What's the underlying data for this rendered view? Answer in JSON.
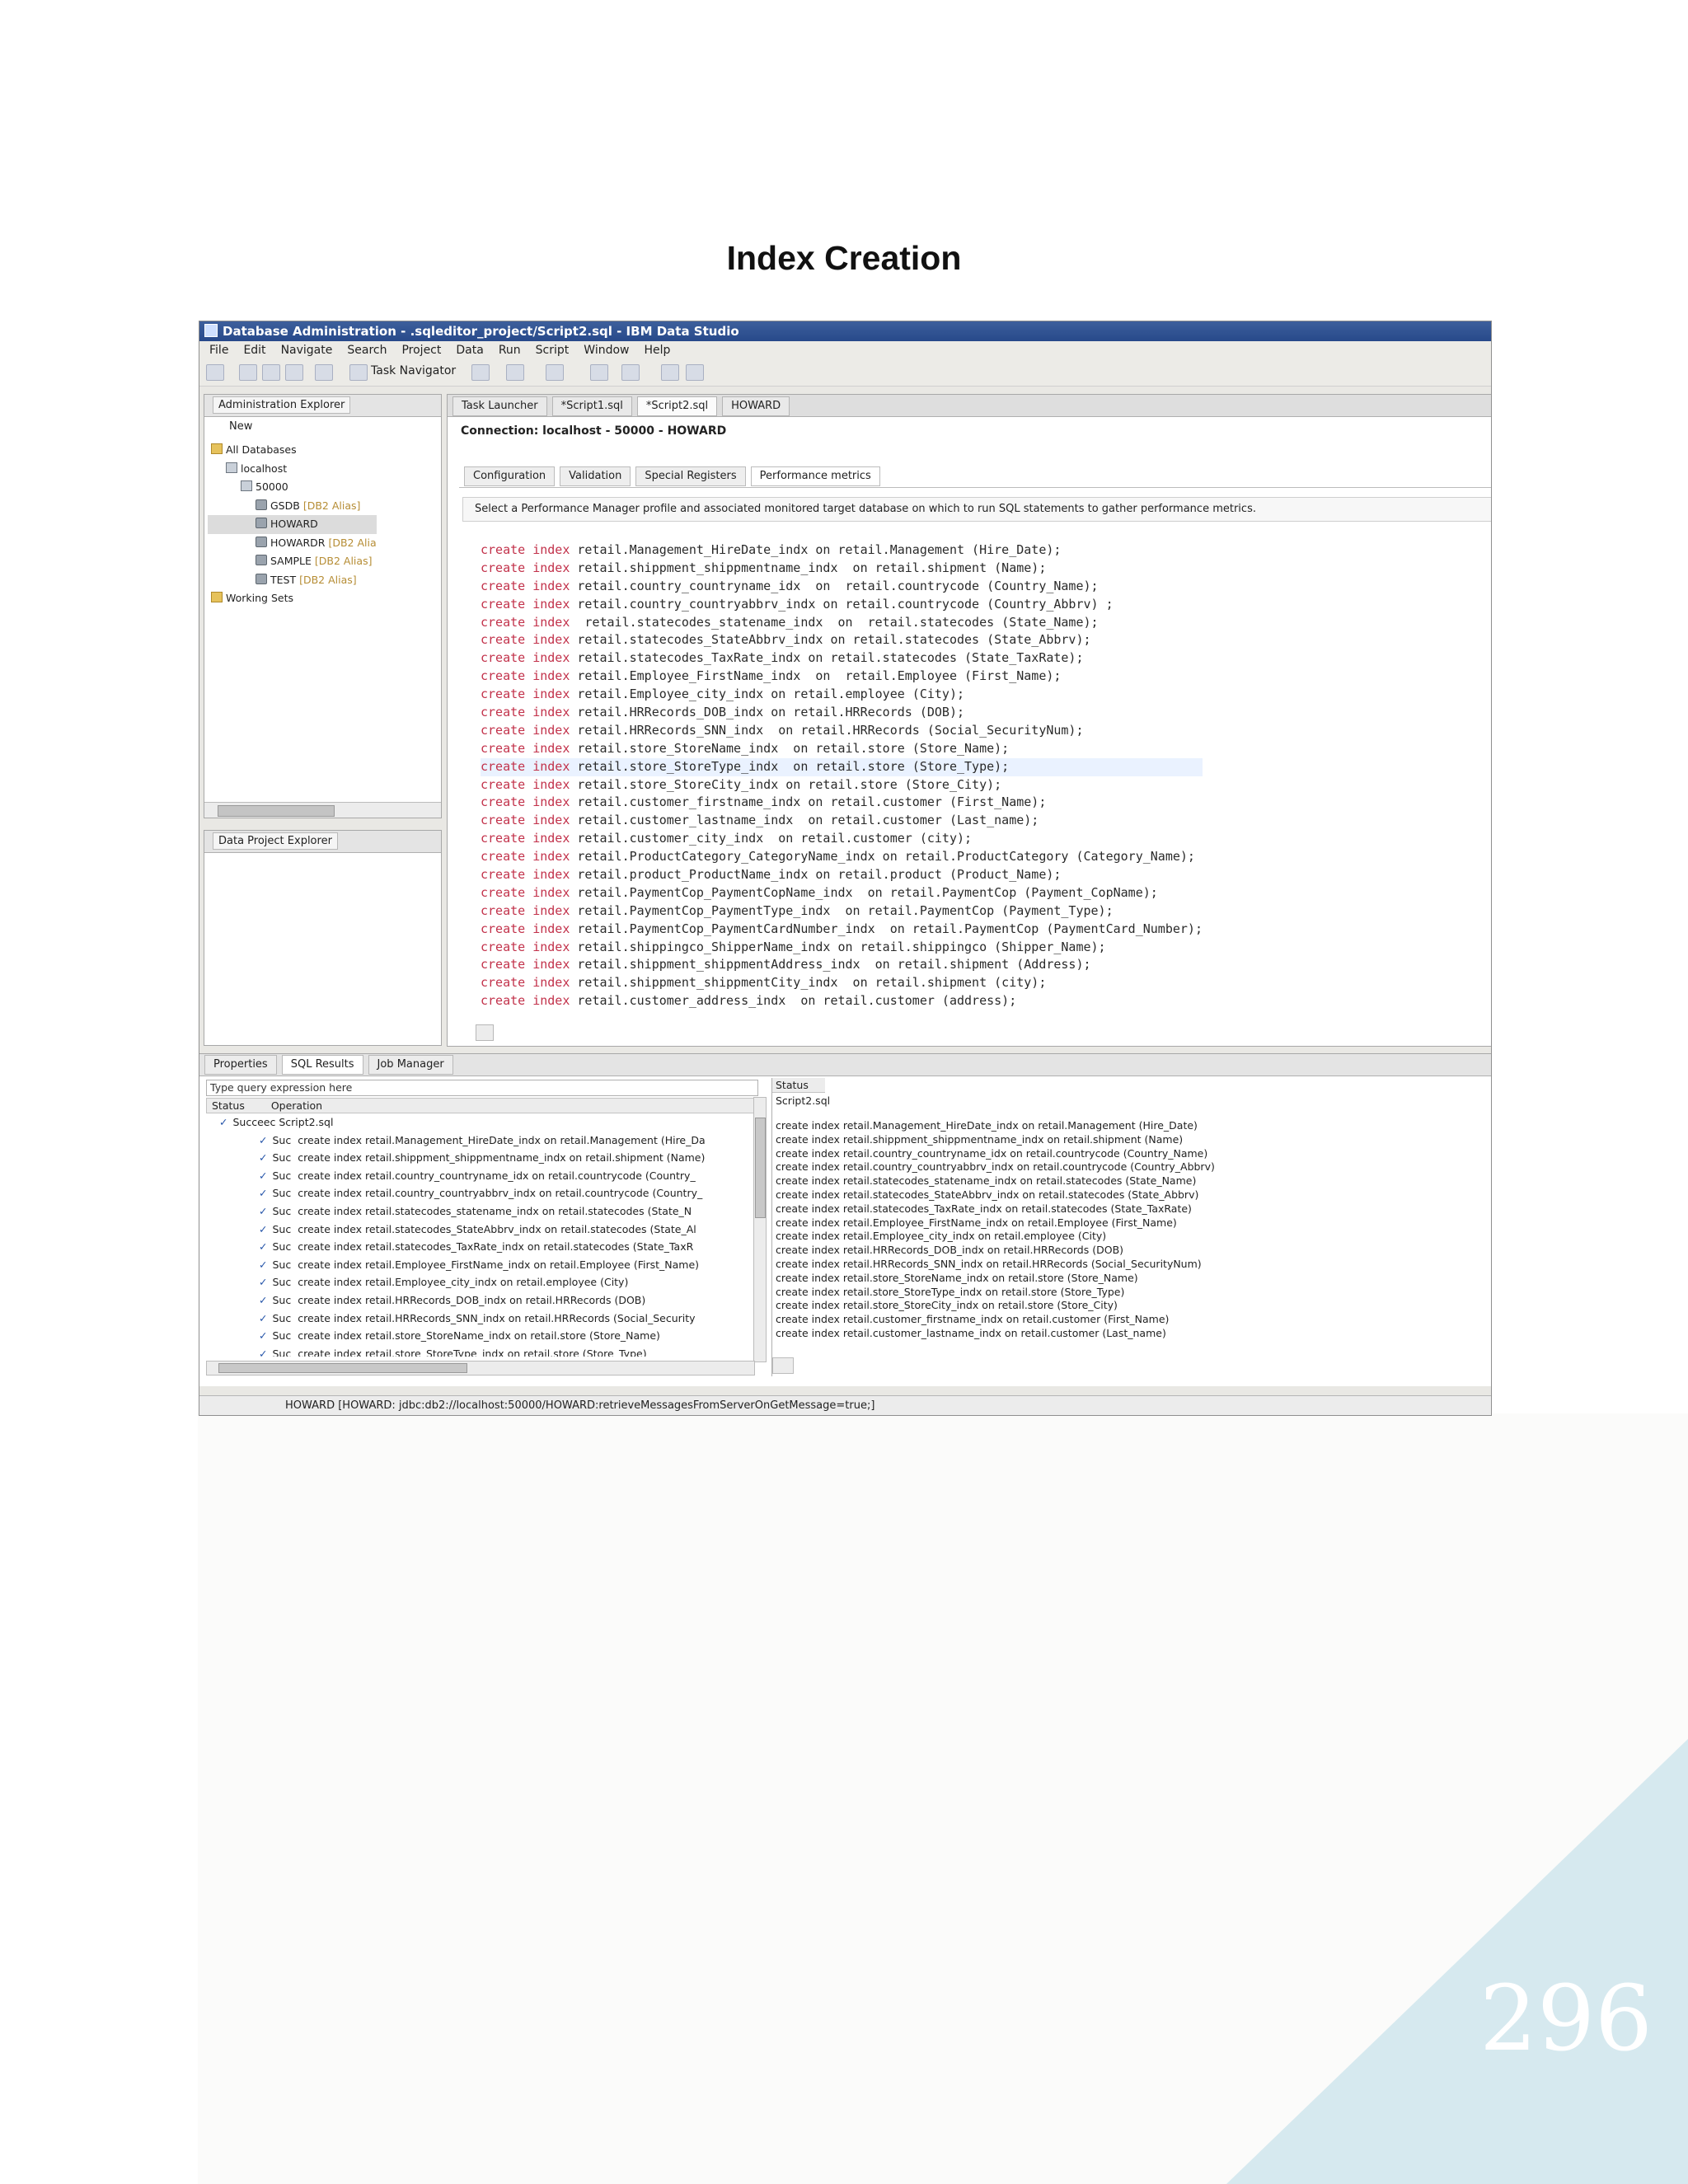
{
  "page": {
    "title": "Index Creation",
    "number": "296"
  },
  "window": {
    "title": "Database Administration - .sqleditor_project/Script2.sql - IBM Data Studio",
    "menu": [
      "File",
      "Edit",
      "Navigate",
      "Search",
      "Project",
      "Data",
      "Run",
      "Script",
      "Window",
      "Help"
    ],
    "toolbar": {
      "task_navigator": "Task Navigator"
    }
  },
  "admin_explorer": {
    "tab": "Administration Explorer",
    "new_label": "New",
    "tree": [
      {
        "label": "All Databases",
        "alias": ""
      },
      {
        "label": "localhost",
        "alias": ""
      },
      {
        "label": "50000",
        "alias": ""
      },
      {
        "label": "GSDB",
        "alias": "[DB2 Alias]"
      },
      {
        "label": "HOWARD",
        "alias": ""
      },
      {
        "label": "HOWARDR",
        "alias": "[DB2 Alia"
      },
      {
        "label": "SAMPLE",
        "alias": "[DB2 Alias]"
      },
      {
        "label": "TEST",
        "alias": "[DB2 Alias]"
      },
      {
        "label": "Working Sets",
        "alias": ""
      }
    ]
  },
  "data_project_explorer": {
    "tab": "Data Project Explorer"
  },
  "editor": {
    "tabs": [
      "Task Launcher",
      "*Script1.sql",
      "*Script2.sql",
      "HOWARD"
    ],
    "connection": "Connection: localhost - 50000 - HOWARD",
    "config_tabs": [
      "Configuration",
      "Validation",
      "Special Registers",
      "Performance metrics"
    ],
    "config_description": "Select a Performance Manager profile and associated monitored target database on which to run SQL statements to gather performance metrics.",
    "keyword": "create index",
    "lines": [
      " retail.Management_HireDate_indx on retail.Management (Hire_Date);",
      " retail.shippment_shippmentname_indx  on retail.shipment (Name);",
      " retail.country_countryname_idx  on  retail.countrycode (Country_Name);",
      " retail.country_countryabbrv_indx on retail.countrycode (Country_Abbrv) ;",
      "  retail.statecodes_statename_indx  on  retail.statecodes (State_Name);",
      " retail.statecodes_StateAbbrv_indx on retail.statecodes (State_Abbrv);",
      " retail.statecodes_TaxRate_indx on retail.statecodes (State_TaxRate);",
      " retail.Employee_FirstName_indx  on  retail.Employee (First_Name);",
      " retail.Employee_city_indx on retail.employee (City);",
      " retail.HRRecords_DOB_indx on retail.HRRecords (DOB);",
      " retail.HRRecords_SNN_indx  on retail.HRRecords (Social_SecurityNum);",
      " retail.store_StoreName_indx  on retail.store (Store_Name);",
      " retail.store_StoreType_indx  on retail.store (Store_Type);",
      " retail.store_StoreCity_indx on retail.store (Store_City);",
      " retail.customer_firstname_indx on retail.customer (First_Name);",
      " retail.customer_lastname_indx  on retail.customer (Last_name);",
      " retail.customer_city_indx  on retail.customer (city);",
      " retail.ProductCategory_CategoryName_indx on retail.ProductCategory (Category_Name);",
      " retail.product_ProductName_indx on retail.product (Product_Name);",
      " retail.PaymentCop_PaymentCopName_indx  on retail.PaymentCop (Payment_CopName);",
      " retail.PaymentCop_PaymentType_indx  on retail.PaymentCop (Payment_Type);",
      " retail.PaymentCop_PaymentCardNumber_indx  on retail.PaymentCop (PaymentCard_Number);",
      " retail.shippingco_ShipperName_indx on retail.shippingco (Shipper_Name);",
      " retail.shippment_shippmentAddress_indx  on retail.shipment (Address);",
      " retail.shippment_shippmentCity_indx  on retail.shipment (city);",
      " retail.customer_address_indx  on retail.customer (address);"
    ]
  },
  "results": {
    "tabs": [
      "Properties",
      "SQL Results",
      "Job Manager"
    ],
    "query_placeholder": "Type query expression here",
    "col_status": "Status",
    "col_operation": "Operation",
    "root": {
      "status": "Succeec",
      "operation": "Script2.sql"
    },
    "rows": [
      {
        "status": "Suc",
        "op": "create index retail.Management_HireDate_indx on retail.Management (Hire_Da"
      },
      {
        "status": "Suc",
        "op": "create index retail.shippment_shippmentname_indx on retail.shipment (Name)"
      },
      {
        "status": "Suc",
        "op": "create index retail.country_countryname_idx on retail.countrycode (Country_"
      },
      {
        "status": "Suc",
        "op": "create index retail.country_countryabbrv_indx on retail.countrycode (Country_"
      },
      {
        "status": "Suc",
        "op": "create index retail.statecodes_statename_indx on retail.statecodes (State_N"
      },
      {
        "status": "Suc",
        "op": "create index retail.statecodes_StateAbbrv_indx on retail.statecodes (State_Al"
      },
      {
        "status": "Suc",
        "op": "create index retail.statecodes_TaxRate_indx on retail.statecodes (State_TaxR"
      },
      {
        "status": "Suc",
        "op": "create index retail.Employee_FirstName_indx on retail.Employee (First_Name)"
      },
      {
        "status": "Suc",
        "op": "create index retail.Employee_city_indx on retail.employee (City)"
      },
      {
        "status": "Suc",
        "op": "create index retail.HRRecords_DOB_indx on retail.HRRecords (DOB)"
      },
      {
        "status": "Suc",
        "op": "create index retail.HRRecords_SNN_indx on retail.HRRecords (Social_Security"
      },
      {
        "status": "Suc",
        "op": "create index retail.store_StoreName_indx on retail.store (Store_Name)"
      },
      {
        "status": "Suc",
        "op": "create index retail.store_StoreType_indx on retail.store (Store_Type)"
      }
    ],
    "status_header": "Status",
    "status_file": "Script2.sql",
    "status_lines": [
      "create index retail.Management_HireDate_indx on retail.Management (Hire_Date)",
      "create index retail.shippment_shippmentname_indx on retail.shipment (Name)",
      "create index retail.country_countryname_idx on retail.countrycode (Country_Name)",
      "create index retail.country_countryabbrv_indx on retail.countrycode (Country_Abbrv)",
      "create index retail.statecodes_statename_indx on retail.statecodes (State_Name)",
      "create index retail.statecodes_StateAbbrv_indx on retail.statecodes (State_Abbrv)",
      "create index retail.statecodes_TaxRate_indx on retail.statecodes (State_TaxRate)",
      "create index retail.Employee_FirstName_indx on retail.Employee (First_Name)",
      "create index retail.Employee_city_indx on retail.employee (City)",
      "create index retail.HRRecords_DOB_indx on retail.HRRecords (DOB)",
      "create index retail.HRRecords_SNN_indx on retail.HRRecords (Social_SecurityNum)",
      "create index retail.store_StoreName_indx on retail.store (Store_Name)",
      "create index retail.store_StoreType_indx on retail.store (Store_Type)",
      "create index retail.store_StoreCity_indx on retail.store (Store_City)",
      "create index retail.customer_firstname_indx on retail.customer (First_Name)",
      "create index retail.customer_lastname_indx on retail.customer (Last_name)"
    ]
  },
  "statusbar": "HOWARD [HOWARD: jdbc:db2://localhost:50000/HOWARD:retrieveMessagesFromServerOnGetMessage=true;]",
  "colors": {
    "sql_keyword": "#c2314a",
    "title_bar": "#2f5191",
    "corner_triangle": "#d6e9ef"
  }
}
